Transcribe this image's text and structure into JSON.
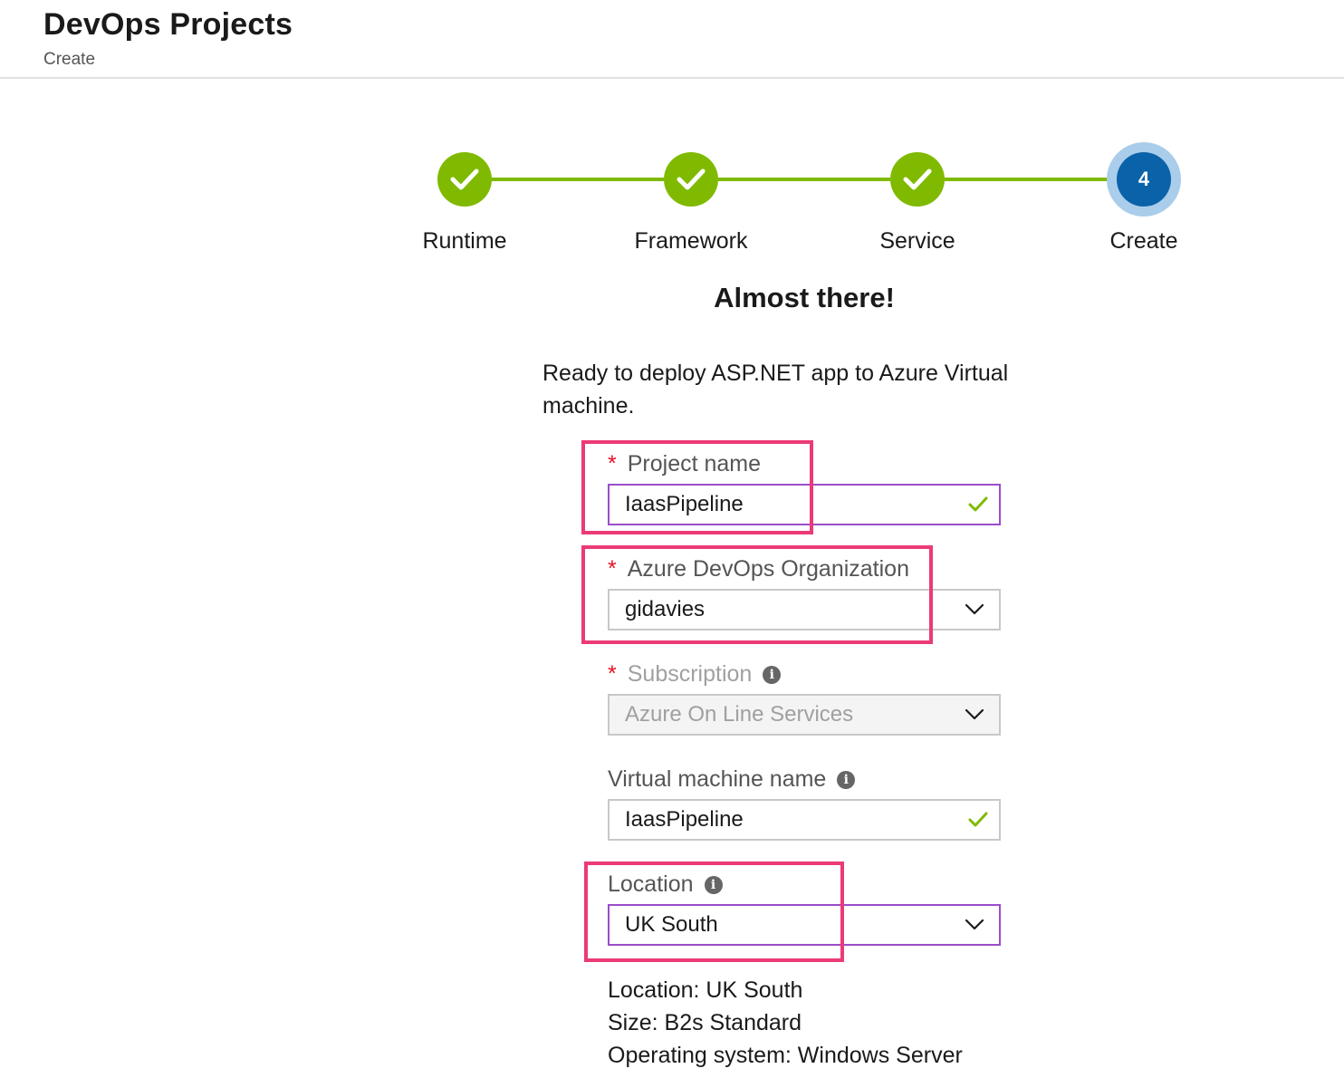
{
  "header": {
    "title": "DevOps Projects",
    "subtitle": "Create"
  },
  "stepper": {
    "steps": [
      {
        "label": "Runtime",
        "status": "complete"
      },
      {
        "label": "Framework",
        "status": "complete"
      },
      {
        "label": "Service",
        "status": "complete"
      },
      {
        "label": "Create",
        "status": "current",
        "number": "4"
      }
    ],
    "complete_color": "#7fba00",
    "current_color": "#0a62a9"
  },
  "main": {
    "heading": "Almost there!",
    "description": "Ready to deploy ASP.NET app to Azure Virtual machine."
  },
  "form": {
    "project_name": {
      "label": "Project name",
      "required": "*",
      "value": "IaasPipeline",
      "icon": "check-icon"
    },
    "organization": {
      "label": "Azure DevOps Organization",
      "required": "*",
      "value": "gidavies",
      "icon": "chevron-down-icon"
    },
    "subscription": {
      "label": "Subscription",
      "required": "*",
      "value": "Azure On Line Services",
      "icon": "chevron-down-icon",
      "info": "i"
    },
    "vm_name": {
      "label": "Virtual machine name",
      "value": "IaasPipeline",
      "icon": "check-icon",
      "info": "i"
    },
    "location": {
      "label": "Location",
      "value": "UK South",
      "icon": "chevron-down-icon",
      "info": "i"
    }
  },
  "summary": {
    "location": "Location:  UK South",
    "size": "Size:  B2s Standard",
    "os": "Operating system:  Windows Server"
  },
  "colors": {
    "highlight": "#ec3a78",
    "required": "#e81123",
    "focus_border": "#9b4dca",
    "valid_check": "#7fba00"
  }
}
